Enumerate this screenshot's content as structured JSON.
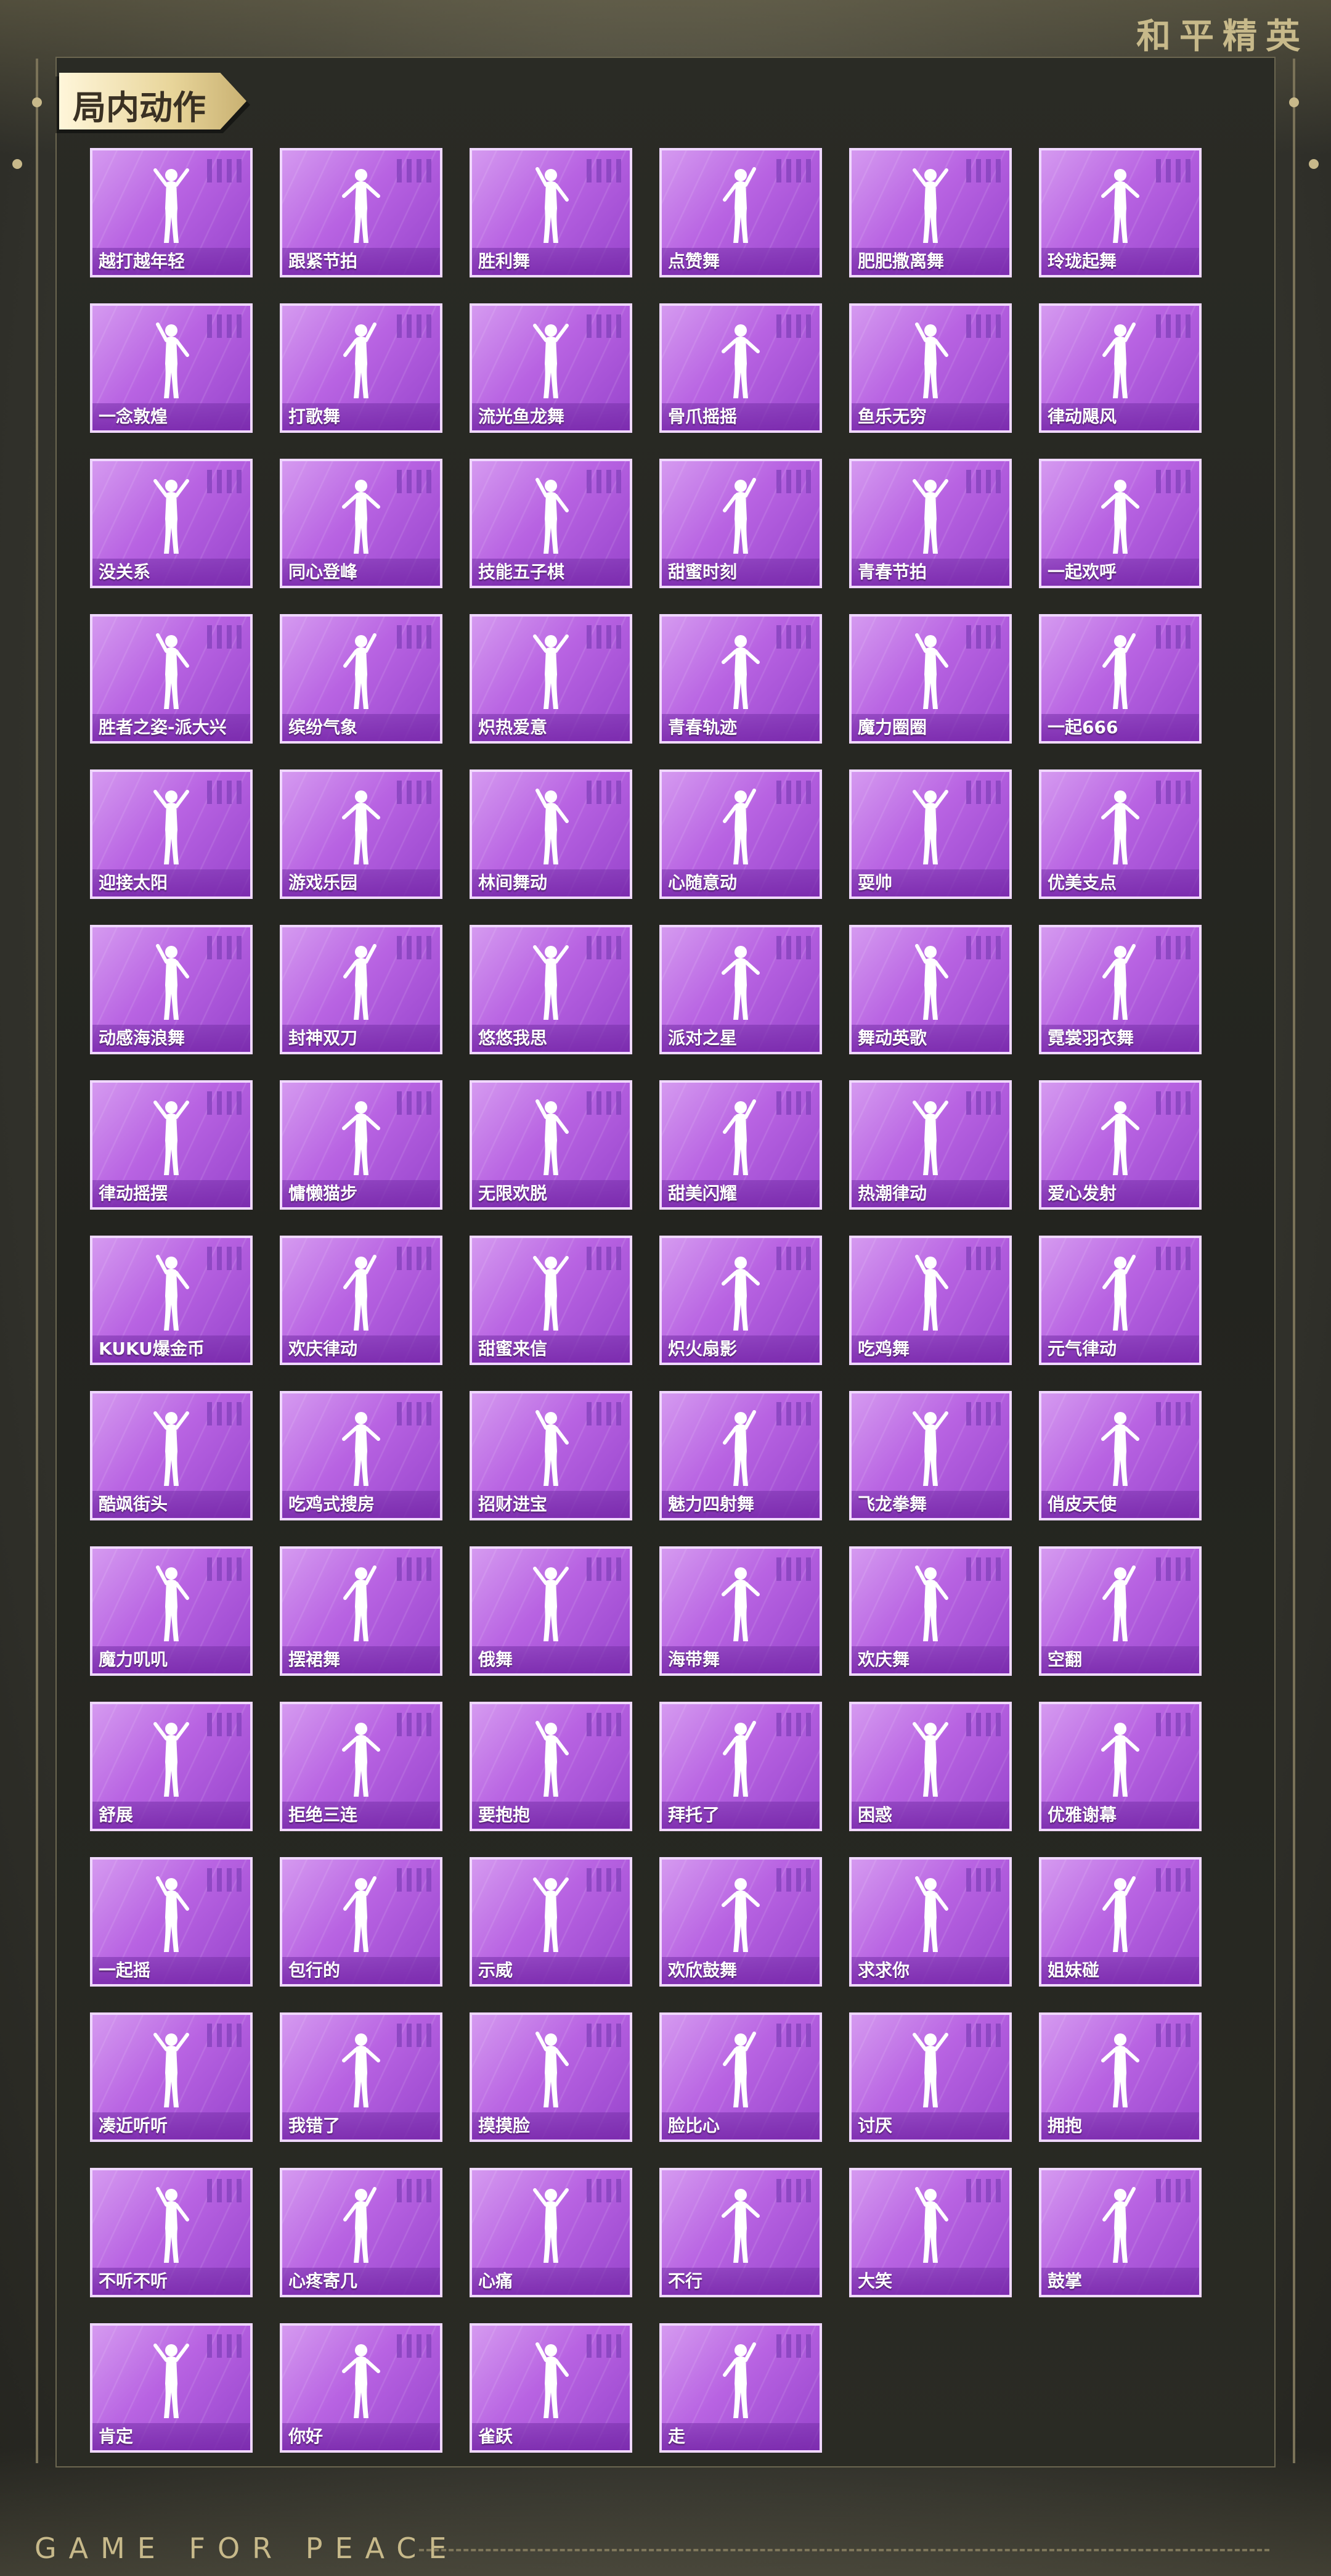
{
  "brand": {
    "title_cn": "和平精英",
    "tagline_en": "GAME FOR PEACE"
  },
  "section": {
    "title": "局内动作"
  },
  "emotes": [
    "越打越年轻",
    "跟紧节拍",
    "胜利舞",
    "点赞舞",
    "肥肥撒离舞",
    "玲珑起舞",
    "一念敦煌",
    "打歌舞",
    "流光鱼龙舞",
    "骨爪摇摇",
    "鱼乐无穷",
    "律动飓风",
    "没关系",
    "同心登峰",
    "技能五子棋",
    "甜蜜时刻",
    "青春节拍",
    "一起欢呼",
    "胜者之姿-派大兴",
    "缤纷气象",
    "炽热爱意",
    "青春轨迹",
    "魔力圈圈",
    "一起666",
    "迎接太阳",
    "游戏乐园",
    "林间舞动",
    "心随意动",
    "耍帅",
    "优美支点",
    "动感海浪舞",
    "封神双刀",
    "悠悠我思",
    "派对之星",
    "舞动英歌",
    "霓裳羽衣舞",
    "律动摇摆",
    "慵懒猫步",
    "无限欢脱",
    "甜美闪耀",
    "热潮律动",
    "爱心发射",
    "KUKU爆金币",
    "欢庆律动",
    "甜蜜来信",
    "炽火扇影",
    "吃鸡舞",
    "元气律动",
    "酷飒街头",
    "吃鸡式搜房",
    "招财进宝",
    "魅力四射舞",
    "飞龙拳舞",
    "俏皮天使",
    "魔力叽叽",
    "摆裙舞",
    "俄舞",
    "海带舞",
    "欢庆舞",
    "空翻",
    "舒展",
    "拒绝三连",
    "要抱抱",
    "拜托了",
    "困惑",
    "优雅谢幕",
    "一起摇",
    "包行的",
    "示威",
    "欢欣鼓舞",
    "求求你",
    "姐妹碰",
    "凑近听听",
    "我错了",
    "摸摸脸",
    "脸比心",
    "讨厌",
    "拥抱",
    "不听不听",
    "心疼寄几",
    "心痛",
    "不行",
    "大笑",
    "鼓掌",
    "肯定",
    "你好",
    "雀跃",
    "走"
  ]
}
